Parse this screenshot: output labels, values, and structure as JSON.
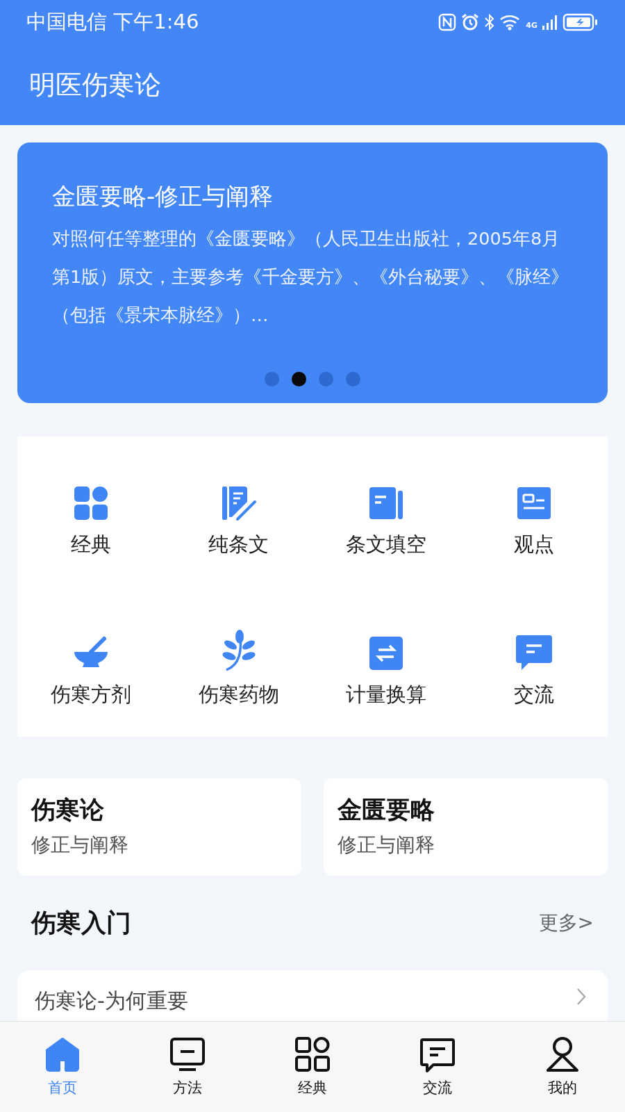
{
  "status_bar": {
    "carrier": "中国电信 下午1:46",
    "network": "4G"
  },
  "app_bar": {
    "title": "明医伤寒论"
  },
  "banner": {
    "title": "金匮要略-修正与阐释",
    "text": "对照何任等整理的《金匮要略》（人民卫生出版社，2005年8月第1版）原文，主要参考《千金要方》、《外台秘要》、《脉经》（包括《景宋本脉经》）…",
    "dots": [
      {
        "selected": false
      },
      {
        "selected": true
      },
      {
        "selected": false
      },
      {
        "selected": false
      }
    ]
  },
  "shortcuts": [
    {
      "label": "经典"
    },
    {
      "label": "纯条文"
    },
    {
      "label": "条文填空"
    },
    {
      "label": "观点"
    },
    {
      "label": "伤寒方剂"
    },
    {
      "label": "伤寒药物"
    },
    {
      "label": "计量换算"
    },
    {
      "label": "交流"
    }
  ],
  "books": [
    {
      "title": "伤寒论",
      "subtitle": "修正与阐释"
    },
    {
      "title": "金匮要略",
      "subtitle": "修正与阐释"
    }
  ],
  "section": {
    "title": "伤寒入门",
    "more": "更多>"
  },
  "articles": [
    {
      "title": "伤寒论-为何重要"
    }
  ],
  "bottom_nav": [
    {
      "label": "首页",
      "selected": true
    },
    {
      "label": "方法",
      "selected": false
    },
    {
      "label": "经典",
      "selected": false
    },
    {
      "label": "交流",
      "selected": false
    },
    {
      "label": "我的",
      "selected": false
    }
  ]
}
